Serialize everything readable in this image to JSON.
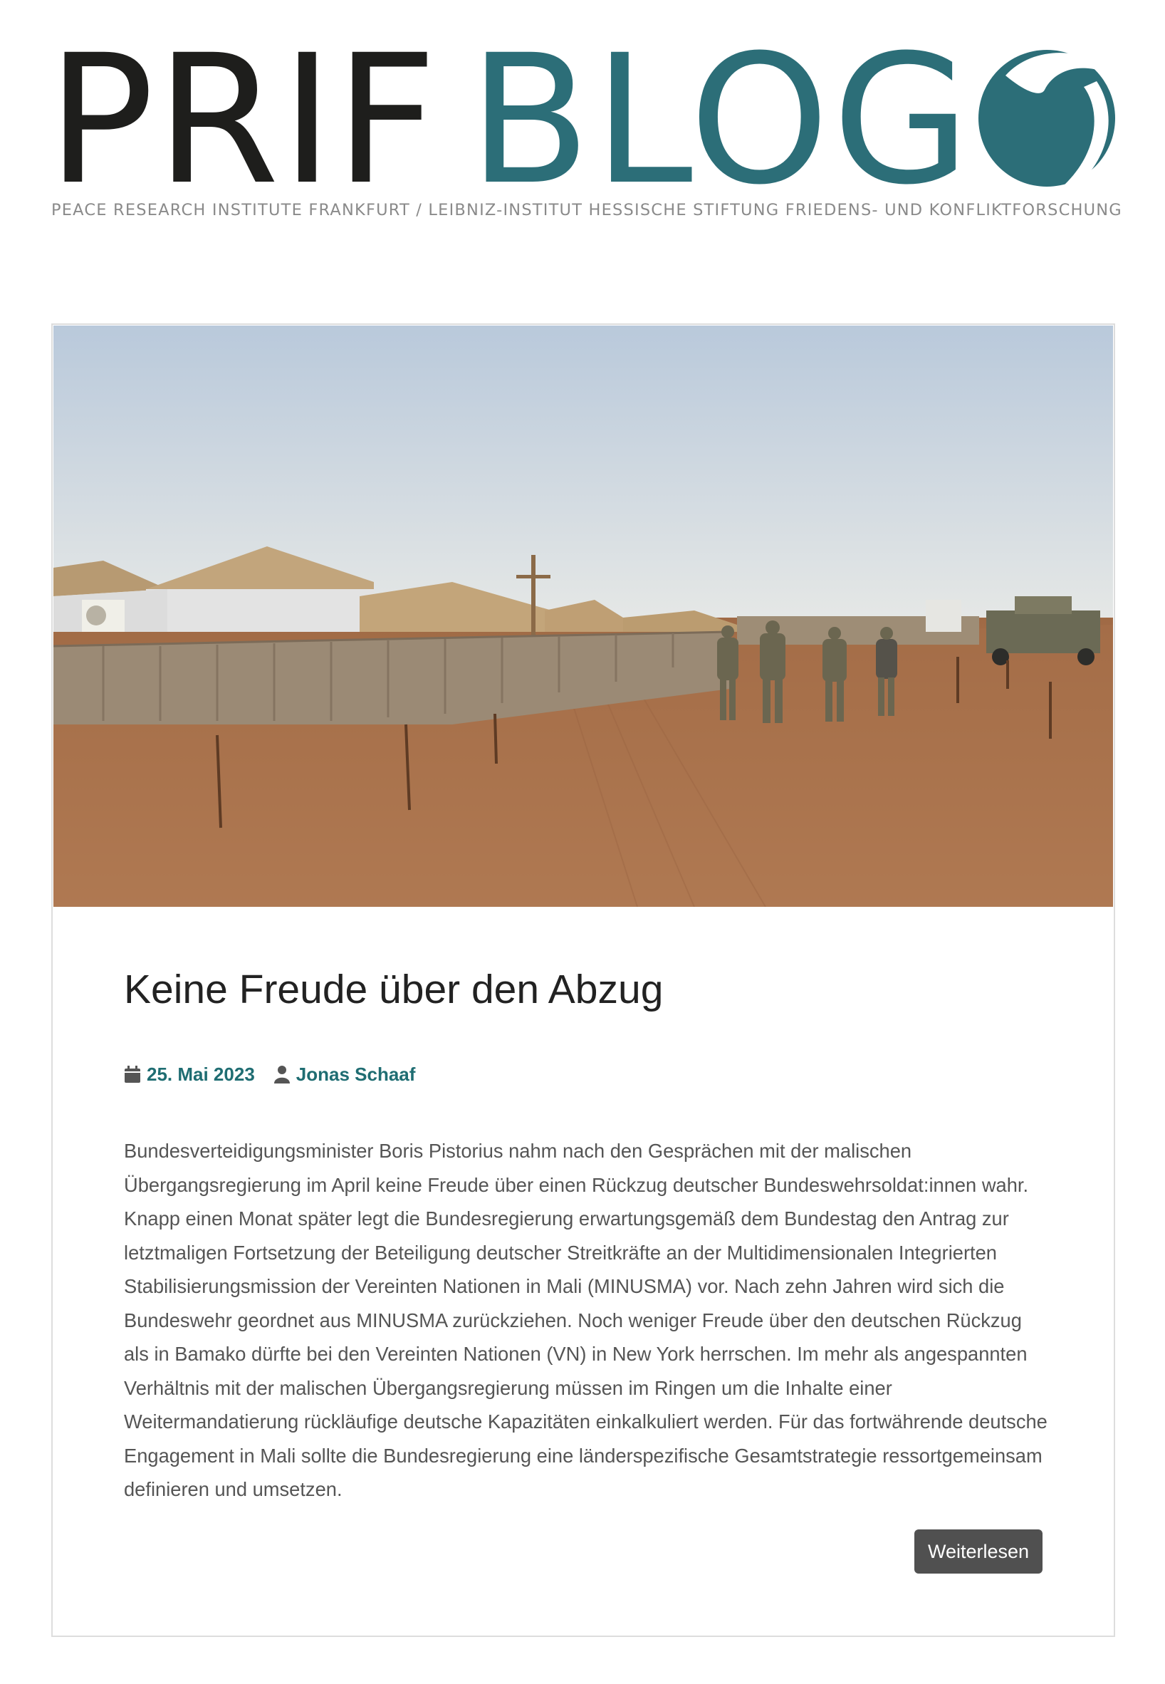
{
  "header": {
    "logo_word1": "PRIF",
    "logo_word2": "BLOG",
    "tagline": "PEACE RESEARCH INSTITUTE FRANKFURT / LEIBNIZ-INSTITUT HESSISCHE STIFTUNG FRIEDENS- UND KONFLIKTFORSCHUNG"
  },
  "post": {
    "title": "Keine Freude über den Abzug",
    "date": "25. Mai 2023",
    "author": "Jonas Schaaf",
    "excerpt": "Bundesverteidigungsminister Boris Pistorius nahm nach den Gesprächen mit der malischen Übergangsregierung im April keine Freude über einen Rückzug deutscher Bundeswehrsoldat:innen wahr. Knapp einen Monat später legt die Bundesregierung erwartungsgemäß dem Bundestag den Antrag zur letztmaligen Fortsetzung der Beteiligung deutscher Streitkräfte an der Multidimensionalen Integrierten Stabilisierungsmission der Vereinten Nationen in Mali (MINUSMA) vor. Nach zehn Jahren wird sich die Bundeswehr geordnet aus MINUSMA zurückziehen. Noch weniger Freude über den deutschen Rückzug als in Bamako dürfte bei den Vereinten Nationen (VN) in New York herrschen. Im mehr als angespannten Verhältnis mit der malischen Übergangsregierung müssen im Ringen um die Inhalte einer Weitermandatierung rückläufige deutsche Kapazitäten einkalkuliert werden. Für das fortwährende deutsche Engagement in Mali sollte die Bundesregierung eine länderspezifische Gesamtstrategie ressortgemeinsam definieren und umsetzen.",
    "read_more": "Weiterlesen"
  },
  "icons": {
    "date_icon": "calendar-icon",
    "author_icon": "user-icon",
    "logo_mark": "prif-globe-logo"
  },
  "colors": {
    "brand_teal": "#2c6e78",
    "logo_dark": "#1e1e1c",
    "meta_link": "#1f6d72",
    "button_bg": "#505050"
  }
}
